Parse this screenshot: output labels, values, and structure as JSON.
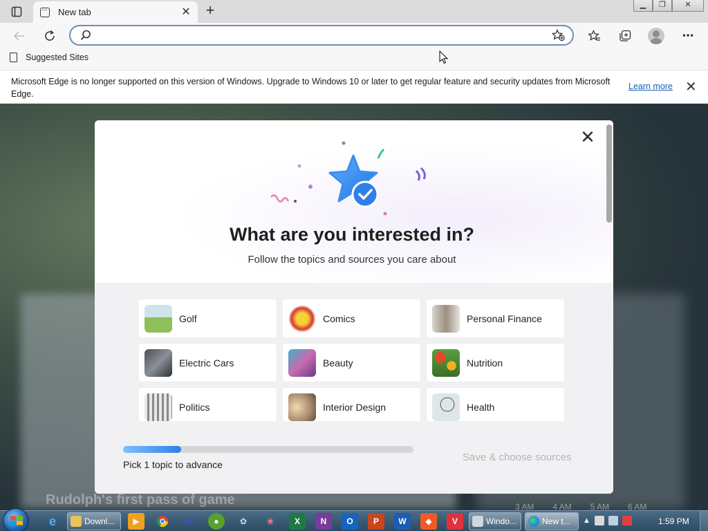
{
  "browser": {
    "tab": {
      "title": "New tab"
    },
    "new_tab_label": "+",
    "address": {
      "value": "",
      "placeholder": ""
    },
    "favorites_bar": {
      "items": [
        {
          "label": "Suggested Sites"
        }
      ]
    },
    "infobar": {
      "message": "Microsoft Edge is no longer supported on this version of Windows. Upgrade to Windows 10 or later to get regular feature and security updates from Microsoft Edge.",
      "link": "Learn more"
    }
  },
  "background": {
    "caption": "Rudolph's first pass of game",
    "times": [
      "3 AM",
      "4 AM",
      "5 AM",
      "6 AM"
    ]
  },
  "modal": {
    "title": "What are you interested in?",
    "subtitle": "Follow the topics and sources you care about",
    "topics": [
      {
        "label": "Golf"
      },
      {
        "label": "Comics"
      },
      {
        "label": "Personal Finance"
      },
      {
        "label": "Electric Cars"
      },
      {
        "label": "Beauty"
      },
      {
        "label": "Nutrition"
      },
      {
        "label": "Politics"
      },
      {
        "label": "Interior Design"
      },
      {
        "label": "Health"
      }
    ],
    "progress": {
      "fraction": 0.2,
      "text": "Pick 1 topic to advance"
    },
    "save_label": "Save & choose sources"
  },
  "taskbar": {
    "windows": [
      {
        "label": "Downl..."
      },
      {
        "label": "Windo..."
      },
      {
        "label": "New t..."
      }
    ],
    "pinned": [
      "internet-explorer",
      "file-explorer",
      "media-player",
      "chrome",
      "app-glasses",
      "app-green",
      "app-network",
      "app-paint",
      "excel",
      "onenote",
      "outlook",
      "powerpoint",
      "word",
      "brave",
      "vivaldi"
    ],
    "clock": "1:59 PM"
  },
  "colors": {
    "accent": "#2f7fe8",
    "address_border": "#6b8db5",
    "link": "#1a5fb4"
  }
}
